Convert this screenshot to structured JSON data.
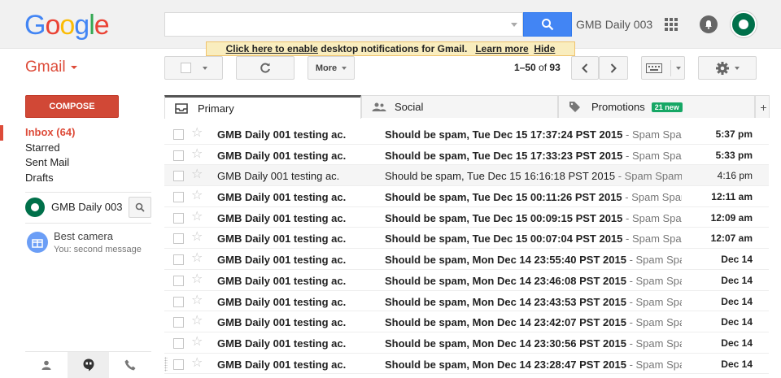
{
  "header": {
    "logo_letters": [
      "G",
      "o",
      "o",
      "g",
      "l",
      "e"
    ],
    "logo_colors": [
      "#4285f4",
      "#ea4335",
      "#fbbc05",
      "#4285f4",
      "#34a853",
      "#ea4335"
    ],
    "account_name": "GMB Daily 003",
    "icons": [
      "search-icon",
      "apps-icon",
      "notifications-icon",
      "account-avatar"
    ]
  },
  "notification": {
    "enable_link": "Click here to enable",
    "text": " desktop notifications for Gmail.",
    "learn_more": "Learn more",
    "hide": "Hide"
  },
  "toolbar": {
    "app_label": "Gmail",
    "more_label": "More",
    "pager_range": "1–50",
    "pager_of": " of ",
    "pager_total": "93"
  },
  "sidebar": {
    "compose_label": "COMPOSE",
    "items": [
      {
        "label": "Inbox (64)",
        "active": true
      },
      {
        "label": "Starred"
      },
      {
        "label": "Sent Mail"
      },
      {
        "label": "Drafts"
      }
    ],
    "hangouts_user": "GMB Daily 003",
    "contact": {
      "name": "Best camera",
      "preview": "You: second message"
    }
  },
  "tabs": [
    {
      "label": "Primary",
      "icon": "inbox-icon"
    },
    {
      "label": "Social",
      "icon": "people-icon"
    },
    {
      "label": "Promotions",
      "icon": "tag-icon",
      "badge": "21 new"
    },
    {
      "label": "+",
      "icon": "plus-icon"
    }
  ],
  "emails": [
    {
      "from": "GMB Daily 001 testing ac.",
      "subject": "Should be spam, Tue Dec 15 17:37:24 PST 2015",
      "snippet": " - Spam Spam",
      "date": "5:37 pm",
      "unread": true
    },
    {
      "from": "GMB Daily 001 testing ac.",
      "subject": "Should be spam, Tue Dec 15 17:33:23 PST 2015",
      "snippet": " - Spam Spam",
      "date": "5:33 pm",
      "unread": true
    },
    {
      "from": "GMB Daily 001 testing ac.",
      "subject": "Should be spam, Tue Dec 15 16:16:18 PST 2015",
      "snippet": " - Spam Spam",
      "date": "4:16 pm",
      "unread": false
    },
    {
      "from": "GMB Daily 001 testing ac.",
      "subject": "Should be spam, Tue Dec 15 00:11:26 PST 2015",
      "snippet": " - Spam Spam",
      "date": "12:11 am",
      "unread": true
    },
    {
      "from": "GMB Daily 001 testing ac.",
      "subject": "Should be spam, Tue Dec 15 00:09:15 PST 2015",
      "snippet": " - Spam Spam",
      "date": "12:09 am",
      "unread": true
    },
    {
      "from": "GMB Daily 001 testing ac.",
      "subject": "Should be spam, Tue Dec 15 00:07:04 PST 2015",
      "snippet": " - Spam Spam",
      "date": "12:07 am",
      "unread": true
    },
    {
      "from": "GMB Daily 001 testing ac.",
      "subject": "Should be spam, Mon Dec 14 23:55:40 PST 2015",
      "snippet": " - Spam Spam",
      "date": "Dec 14",
      "unread": true
    },
    {
      "from": "GMB Daily 001 testing ac.",
      "subject": "Should be spam, Mon Dec 14 23:46:08 PST 2015",
      "snippet": " - Spam Spam",
      "date": "Dec 14",
      "unread": true
    },
    {
      "from": "GMB Daily 001 testing ac.",
      "subject": "Should be spam, Mon Dec 14 23:43:53 PST 2015",
      "snippet": " - Spam Spam",
      "date": "Dec 14",
      "unread": true
    },
    {
      "from": "GMB Daily 001 testing ac.",
      "subject": "Should be spam, Mon Dec 14 23:42:07 PST 2015",
      "snippet": " - Spam Spam",
      "date": "Dec 14",
      "unread": true
    },
    {
      "from": "GMB Daily 001 testing ac.",
      "subject": "Should be spam, Mon Dec 14 23:30:56 PST 2015",
      "snippet": " - Spam Spam",
      "date": "Dec 14",
      "unread": true
    },
    {
      "from": "GMB Daily 001 testing ac.",
      "subject": "Should be spam, Mon Dec 14 23:28:47 PST 2015",
      "snippet": " - Spam Spam",
      "date": "Dec 14",
      "unread": true
    }
  ],
  "colors": {
    "accent": "#dd4b39",
    "compose": "#d14836",
    "search_button": "#4285f4",
    "badge": "#16a765"
  }
}
